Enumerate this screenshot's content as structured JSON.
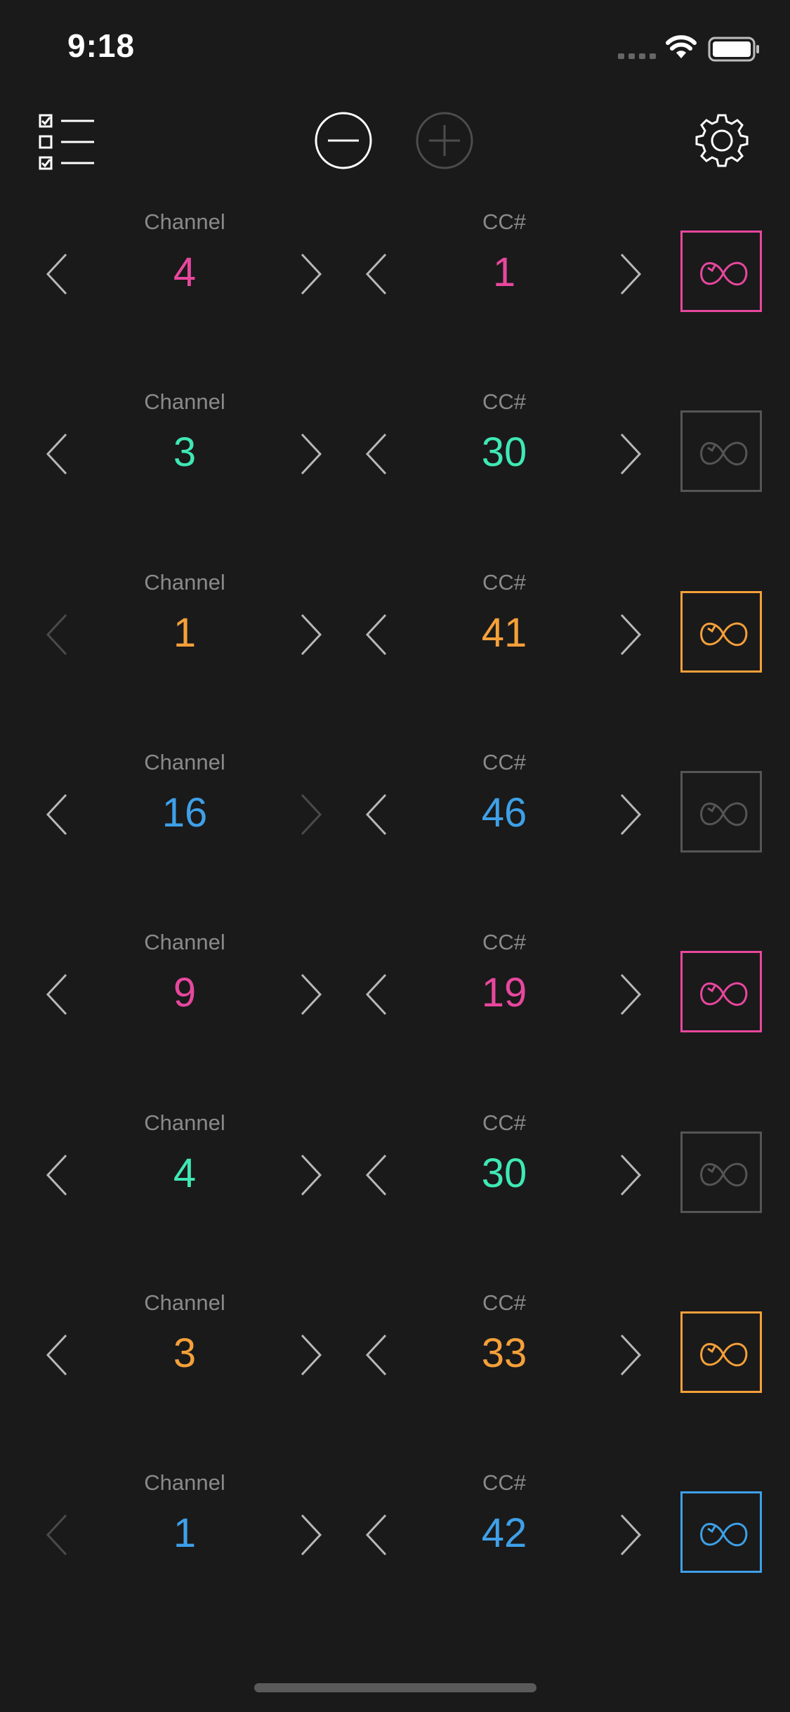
{
  "status": {
    "time": "9:18"
  },
  "colors": {
    "magenta": "#e8479e",
    "green": "#3fe8b4",
    "orange": "#f5a03a",
    "blue": "#3ea0e8",
    "inactive": "#555555",
    "chevron": "#b8b8b8",
    "chevron_disabled": "#4a4a4a"
  },
  "toolbar": {
    "list_icon": "checklist-icon",
    "remove_icon": "minus-circle-icon",
    "add_icon": "plus-circle-icon",
    "add_enabled": false,
    "settings_icon": "gear-icon"
  },
  "labels": {
    "channel": "Channel",
    "cc": "CC#"
  },
  "rows": [
    {
      "channel": "4",
      "cc": "1",
      "color": "#e8479e",
      "loop_active": true,
      "ch_prev_enabled": true,
      "ch_next_enabled": true
    },
    {
      "channel": "3",
      "cc": "30",
      "color": "#3fe8b4",
      "loop_active": false,
      "ch_prev_enabled": true,
      "ch_next_enabled": true
    },
    {
      "channel": "1",
      "cc": "41",
      "color": "#f5a03a",
      "loop_active": true,
      "ch_prev_enabled": false,
      "ch_next_enabled": true
    },
    {
      "channel": "16",
      "cc": "46",
      "color": "#3ea0e8",
      "loop_active": false,
      "ch_prev_enabled": true,
      "ch_next_enabled": false
    },
    {
      "channel": "9",
      "cc": "19",
      "color": "#e8479e",
      "loop_active": true,
      "ch_prev_enabled": true,
      "ch_next_enabled": true
    },
    {
      "channel": "4",
      "cc": "30",
      "color": "#3fe8b4",
      "loop_active": false,
      "ch_prev_enabled": true,
      "ch_next_enabled": true
    },
    {
      "channel": "3",
      "cc": "33",
      "color": "#f5a03a",
      "loop_active": true,
      "ch_prev_enabled": true,
      "ch_next_enabled": true
    },
    {
      "channel": "1",
      "cc": "42",
      "color": "#3ea0e8",
      "loop_active": true,
      "ch_prev_enabled": false,
      "ch_next_enabled": true
    }
  ]
}
